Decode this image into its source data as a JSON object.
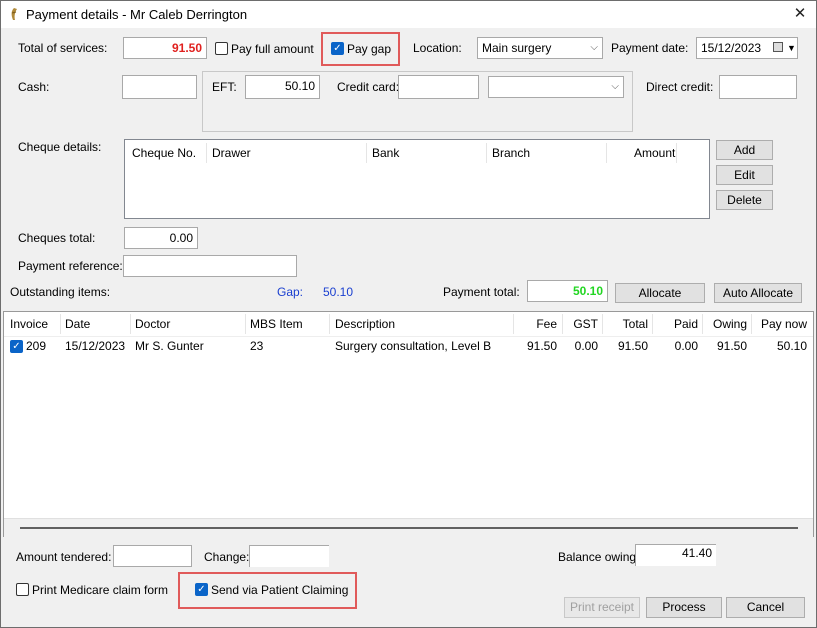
{
  "window": {
    "title": "Payment details - Mr Caleb Derrington",
    "close_glyph": "✕"
  },
  "top": {
    "total_services_label": "Total of services:",
    "total_services_value": "91.50",
    "pay_full_label": "Pay full amount",
    "pay_full_checked": false,
    "pay_gap_label": "Pay gap",
    "pay_gap_checked": true,
    "location_label": "Location:",
    "location_value": "Main surgery",
    "payment_date_label": "Payment date:",
    "payment_date_value": "15/12/2023"
  },
  "methods": {
    "cash_label": "Cash:",
    "cash_value": "",
    "eft_label": "EFT:",
    "eft_value": "50.10",
    "credit_card_label": "Credit card:",
    "credit_card_value": "",
    "credit_card_type": "",
    "direct_credit_label": "Direct credit:",
    "direct_credit_value": ""
  },
  "cheques": {
    "label": "Cheque details:",
    "columns": [
      "Cheque No.",
      "Drawer",
      "Bank",
      "Branch",
      "Amount"
    ],
    "add_label": "Add",
    "edit_label": "Edit",
    "delete_label": "Delete",
    "total_label": "Cheques total:",
    "total_value": "0.00"
  },
  "reference": {
    "label": "Payment reference:",
    "value": ""
  },
  "outstanding": {
    "label": "Outstanding items:",
    "gap_label": "Gap:",
    "gap_value": "50.10",
    "payment_total_label": "Payment total:",
    "payment_total_value": "50.10",
    "allocate_label": "Allocate",
    "auto_allocate_label": "Auto Allocate"
  },
  "items_table": {
    "columns": [
      "Invoice",
      "Date",
      "Doctor",
      "MBS Item",
      "Description",
      "Fee",
      "GST",
      "Total",
      "Paid",
      "Owing",
      "Pay now"
    ],
    "rows": [
      {
        "checked": true,
        "invoice": "209",
        "date": "15/12/2023",
        "doctor": "Mr S. Gunter",
        "mbs_item": "23",
        "description": "Surgery consultation, Level B",
        "fee": "91.50",
        "gst": "0.00",
        "total": "91.50",
        "paid": "0.00",
        "owing": "91.50",
        "pay_now": "50.10"
      }
    ]
  },
  "bottom": {
    "amount_tendered_label": "Amount tendered:",
    "amount_tendered_value": "",
    "change_label": "Change:",
    "change_value": "",
    "balance_owing_label": "Balance owing:",
    "balance_owing_value": "41.40",
    "print_medicare_label": "Print Medicare claim form",
    "print_medicare_checked": false,
    "send_claiming_label": "Send via Patient Claiming",
    "send_claiming_checked": true,
    "print_receipt_label": "Print receipt",
    "process_label": "Process",
    "cancel_label": "Cancel"
  },
  "colors": {
    "total_red": "#e0201e",
    "gap_blue": "#1a3fd0",
    "total_green": "#22d622",
    "highlight_box": "#e05a5a",
    "check_blue": "#0a64c8"
  }
}
